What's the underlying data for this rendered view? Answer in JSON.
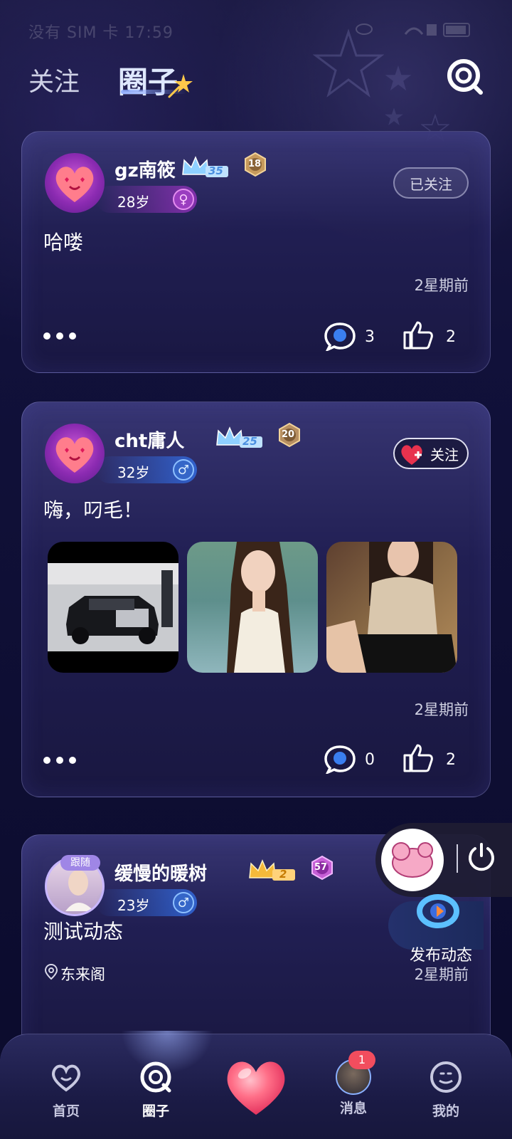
{
  "status_bar": {
    "text": "没有 SIM 卡 17:59"
  },
  "top_tabs": {
    "follow": "关注",
    "circle": "圈子"
  },
  "posts": [
    {
      "username": "gz南筱",
      "crown_level": "35",
      "medal_level": "18",
      "age": "28岁",
      "gender": "female",
      "follow_label": "已关注",
      "content": "哈喽",
      "time": "2星期前",
      "comments": "3",
      "likes": "2"
    },
    {
      "username": "cht庸人",
      "crown_level": "25",
      "medal_level": "20",
      "age": "32岁",
      "gender": "male",
      "follow_label": "关注",
      "content": "嗨，叼毛！",
      "time": "2星期前",
      "comments": "0",
      "likes": "2"
    },
    {
      "username": "缓慢的暖树",
      "avatar_badge": "跟随",
      "crown_level": "2",
      "medal_level": "57",
      "age": "23岁",
      "gender": "male",
      "content": "测试动态",
      "location": "东来阁",
      "time": "2星期前"
    }
  ],
  "publish": {
    "label": "发布动态"
  },
  "tabbar": {
    "home": "首页",
    "circle": "圈子",
    "messages": "消息",
    "mine": "我的",
    "message_badge": "1"
  }
}
